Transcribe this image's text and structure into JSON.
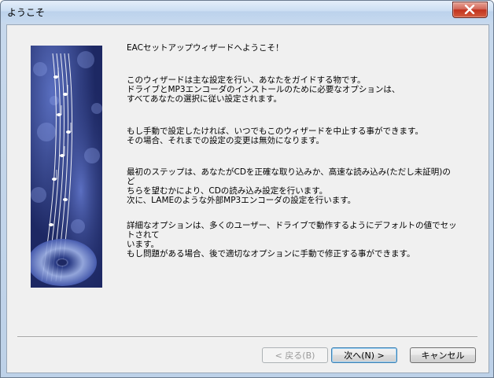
{
  "window": {
    "title": "ようこそ"
  },
  "content": {
    "heading": "EACセットアップウィザードへようこそ！",
    "paragraphs": [
      "このウィザードは主な設定を行い、あなたをガイドする物です。\nドライブとMP3エンコーダのインストールのために必要なオプションは、\nすべてあなたの選択に従い設定されます。",
      "もし手動で設定したければ、いつでもこのウィザードを中止する事ができます。\nその場合、それまでの設定の変更は無効になります。",
      "最初のステップは、あなたがCDを正確な取り込みか、高速な読み込み(ただし未証明)のど\nちらを望むかにより、CDの読み込み設定を行います。\n次に、LAMEのような外部MP3エンコーダの設定を行います。",
      "詳細なオプションは、多くのユーザー、ドライブで動作するようにデフォルトの値でセットされて\nいます。\nもし問題がある場合、後で適切なオプションに手動で修正する事ができます。"
    ]
  },
  "buttons": {
    "back": "< 戻る(B)",
    "next": "次へ(N) >",
    "cancel": "キャンセル"
  },
  "icons": {
    "close": "close-icon",
    "banner": "music-staff-cd-banner"
  },
  "colors": {
    "banner_bg": "#27346f",
    "close_red": "#c2331e"
  }
}
